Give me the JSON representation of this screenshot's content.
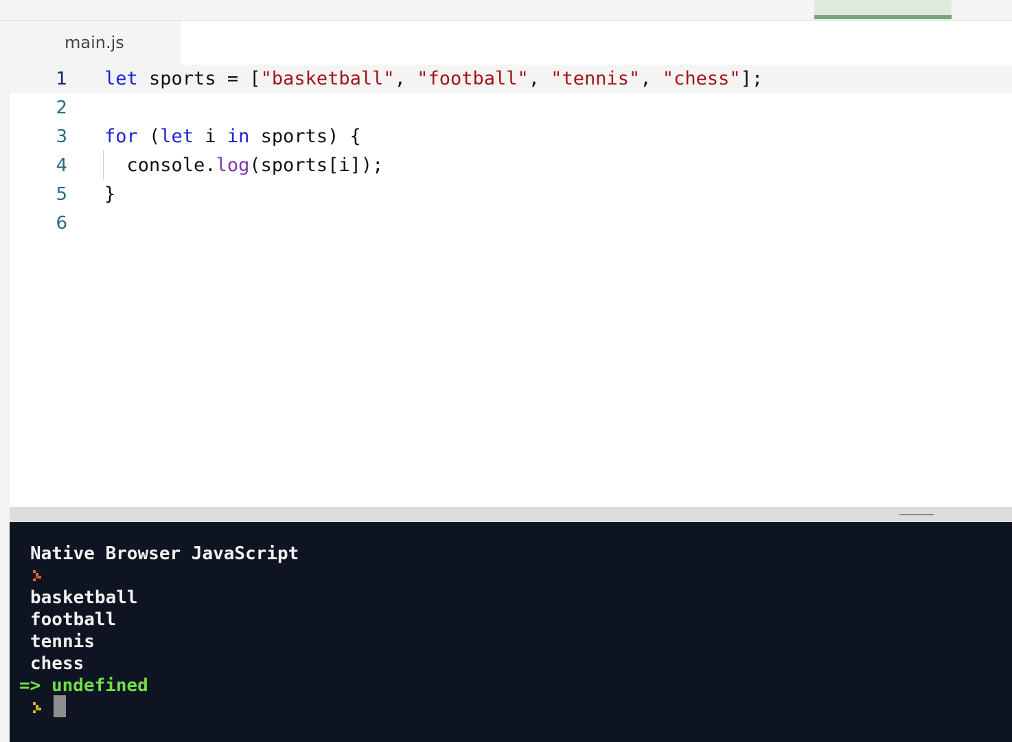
{
  "editor": {
    "tab_label": "main.js",
    "lines": [
      {
        "number": "1"
      },
      {
        "number": "2"
      },
      {
        "number": "3"
      },
      {
        "number": "4"
      },
      {
        "number": "5"
      },
      {
        "number": "6"
      }
    ],
    "code": {
      "l1": {
        "kw": "let",
        "a": " sports = [",
        "s1": "\"basketball\"",
        "c1": ", ",
        "s2": "\"football\"",
        "c2": ", ",
        "s3": "\"tennis\"",
        "c3": ", ",
        "s4": "\"chess\"",
        "end": "];"
      },
      "l3": {
        "kw1": "for",
        "a": " (",
        "kw2": "let",
        "b": " i ",
        "kw3": "in",
        "c": " sports) {"
      },
      "l4": {
        "a": "  console.",
        "fn": "log",
        "b": "(sports[i]);"
      },
      "l5": {
        "a": "}"
      }
    }
  },
  "console": {
    "header": "Native Browser JavaScript",
    "output": [
      "basketball",
      "football",
      "tennis",
      "chess"
    ],
    "result": "=> undefined"
  },
  "colors": {
    "keyword": "#1a22d9",
    "string": "#a31515",
    "function": "#7a3bb0",
    "console_bg": "#0e1421",
    "result": "#6fe046"
  }
}
